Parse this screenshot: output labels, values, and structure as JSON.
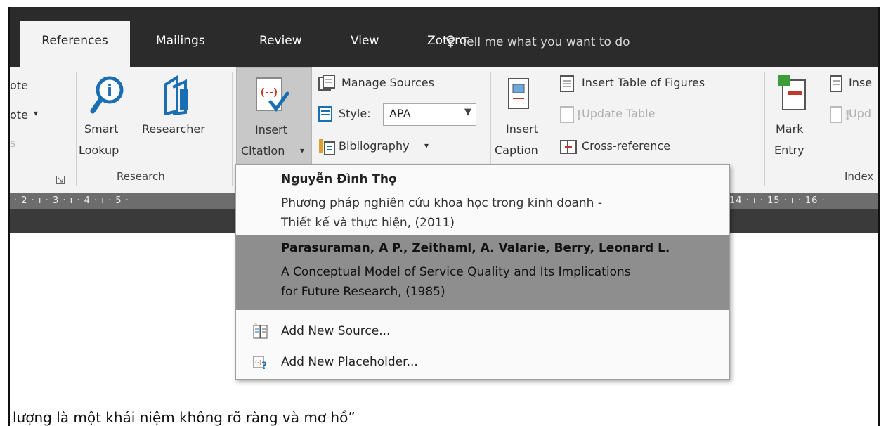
{
  "tabs": {
    "references": "References",
    "mailings": "Mailings",
    "review": "Review",
    "view": "View",
    "zotero": "Zotero",
    "tell_me": "Tell me what you want to do"
  },
  "ribbon": {
    "footnotes": {
      "line1": "ote",
      "line2": "ote",
      "line3": "s"
    },
    "research": {
      "smart_lookup_1": "Smart",
      "smart_lookup_2": "Lookup",
      "researcher": "Researcher",
      "group_label": "Research"
    },
    "citations": {
      "insert_citation_1": "Insert",
      "insert_citation_2": "Citation",
      "manage_sources": "Manage Sources",
      "style_label": "Style:",
      "style_value": "APA",
      "bibliography": "Bibliography"
    },
    "captions": {
      "insert_caption_1": "Insert",
      "insert_caption_2": "Caption",
      "insert_table_of_figures": "Insert Table of Figures",
      "update_table": "Update Table",
      "cross_reference": "Cross-reference"
    },
    "index": {
      "mark_entry_1": "Mark",
      "mark_entry_2": "Entry",
      "insert_index": "Inse",
      "update_index": "Upd",
      "group_label": "Index"
    }
  },
  "ruler": {
    "left_ticks": "· 2 · ı · 3 · ı · 4 · ı · 5 ·",
    "right_ticks": "14 · ı · 15 · ı · 16 ·"
  },
  "citation_menu": {
    "sources": [
      {
        "author": "Nguyễn Đình Thọ",
        "title_line1": "Phương pháp nghiên cứu khoa học trong kinh doanh -",
        "title_line2": "Thiết kế và thực hiện, (2011)"
      },
      {
        "author": "Parasuraman, A P., Zeithaml, A. Valarie,  Berry, Leonard L.",
        "title_line1": "A Conceptual Model of Service Quality and Its Implications",
        "title_line2": "for Future Research, (1985)"
      }
    ],
    "add_new_source": "Add New Source...",
    "add_new_placeholder": "Add New Placeholder..."
  },
  "document": {
    "text": "lượng là một khái niệm không rõ ràng và mơ hồ”"
  }
}
